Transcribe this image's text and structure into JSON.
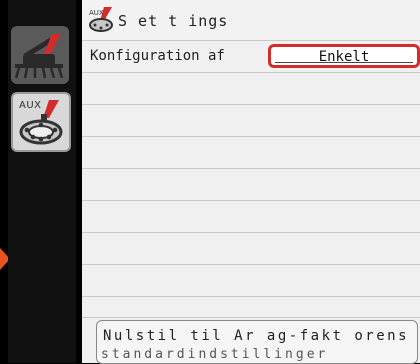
{
  "window": {
    "title": "S et t ings",
    "title_icon": "sprayer-settings-icon"
  },
  "sidebar": {
    "tabs": [
      {
        "icon": "sprayer-boom-icon",
        "active": false
      },
      {
        "icon": "aux-nozzle-icon",
        "label": "AUX",
        "active": true
      }
    ]
  },
  "settings": {
    "rows": [
      {
        "label": "Konfiguration af",
        "value": "Enkelt",
        "highlighted": true
      }
    ],
    "empty_row_count": 8
  },
  "reset_button": {
    "line1": "Nulstil til Ar ag-fakt orens",
    "line2": "standardindstillinger"
  },
  "colors": {
    "highlight": "#d42b2b",
    "indicator_arrow": "#e8531e",
    "panel_bg": "#f0f0f0"
  }
}
